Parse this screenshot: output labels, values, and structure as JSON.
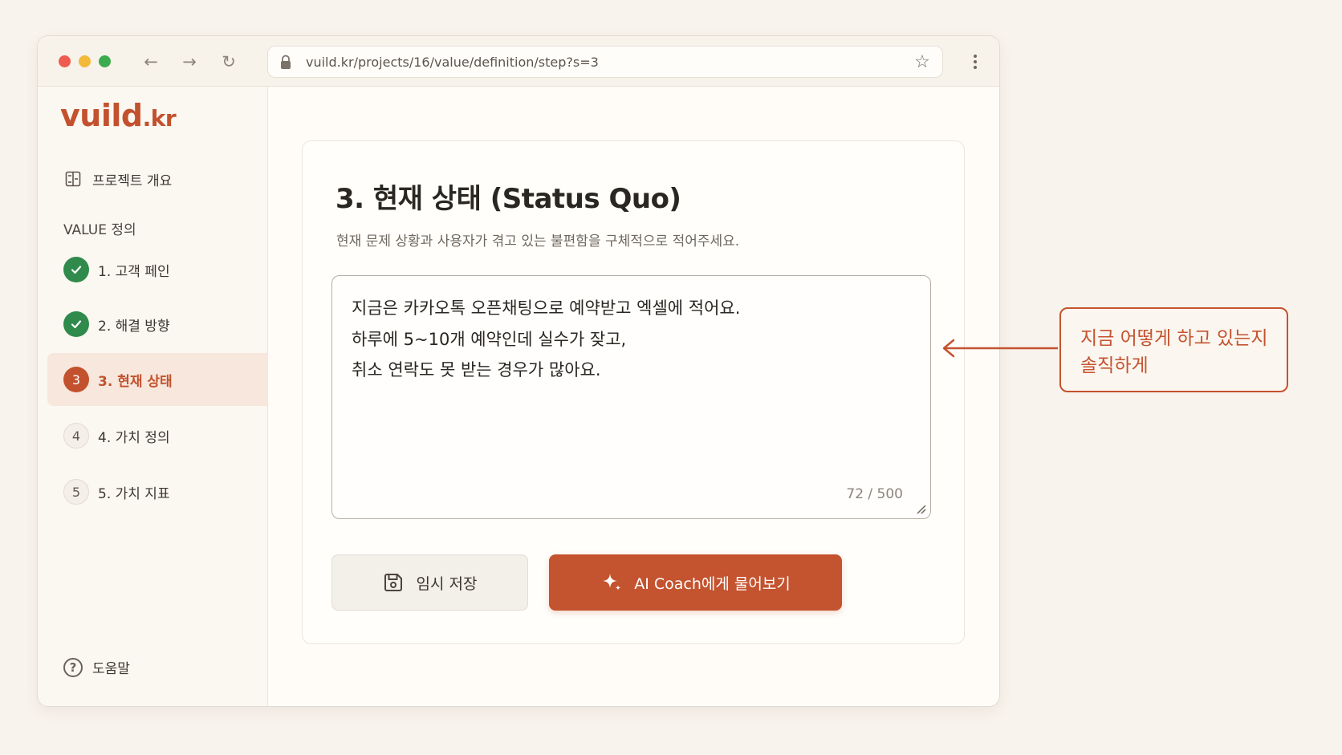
{
  "browser": {
    "url": "vuild.kr/projects/16/value/definition/step?s=3"
  },
  "sidebar": {
    "logo_main": "vuild",
    "logo_tld": ".kr",
    "overview_label": "프로젝트 개요",
    "section_label": "VALUE 정의",
    "steps": [
      {
        "badge": "",
        "label": "1. 고객 페인",
        "status": "done"
      },
      {
        "badge": "",
        "label": "2. 해결 방향",
        "status": "done"
      },
      {
        "badge": "3",
        "label": "3. 현재 상태",
        "status": "current"
      },
      {
        "badge": "4",
        "label": "4. 가치 정의",
        "status": "todo"
      },
      {
        "badge": "5",
        "label": "5. 가치 지표",
        "status": "todo"
      }
    ],
    "help_label": "도움말"
  },
  "main": {
    "title": "3. 현재 상태 (Status Quo)",
    "subtitle": "현재 문제 상황과 사용자가 겪고 있는 불편함을 구체적으로 적어주세요.",
    "answer_lines": [
      "지금은 카카오톡 오픈채팅으로 예약받고 엑셀에 적어요.",
      "하루에 5~10개 예약인데 실수가 잦고,",
      "취소 연락도 못 받는 경우가 많아요."
    ],
    "counter": "72 / 500",
    "save_label": "임시 저장",
    "ai_label": "AI Coach에게 물어보기"
  },
  "annotation": {
    "lines": [
      "지금 어떻게 하고 있는지",
      "솔직하게"
    ]
  },
  "colors": {
    "accent": "#c4532f",
    "done": "#2f8a4b",
    "background": "#f8f3ec"
  },
  "icons": [
    "lock-icon",
    "star-icon",
    "menu-icon",
    "overview-icon",
    "check-icon",
    "help-icon",
    "floppy-icon",
    "sparkle-icon",
    "arrow-left-icon"
  ]
}
